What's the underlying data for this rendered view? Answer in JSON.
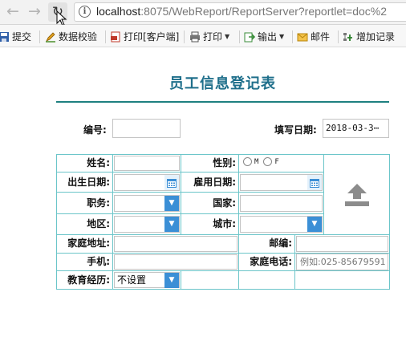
{
  "browser": {
    "url_host": "localhost",
    "url_rest": ":8075/WebReport/ReportServer?reportlet=doc%2"
  },
  "toolbar": {
    "submit": "提交",
    "validate": "数据校验",
    "print_client": "打印[客户端]",
    "print": "打印",
    "export": "输出",
    "mail": "邮件",
    "add_record": "增加记录"
  },
  "form": {
    "title": "员工信息登记表",
    "number_label": "编号:",
    "number_value": "",
    "fill_date_label": "填写日期:",
    "fill_date_value": "2018-03-3⋯",
    "name_label": "姓名:",
    "gender_label": "性别:",
    "gender_options": [
      "M",
      "F"
    ],
    "birth_date_label": "出生日期:",
    "hire_date_label": "雇用日期:",
    "position_label": "职务:",
    "country_label": "国家:",
    "region_label": "地区:",
    "city_label": "城市:",
    "address_label": "家庭地址:",
    "postcode_label": "邮编:",
    "mobile_label": "手机:",
    "home_phone_label": "家庭电话:",
    "home_phone_placeholder": "例如:025-85679591",
    "education_label": "教育经历:",
    "education_value": "不设置"
  },
  "colors": {
    "title": "#1f6f8b",
    "rule": "#1e8080",
    "grid": "#6bc5c9",
    "select_arrow": "#3b8fd6",
    "upload_icon": "#8c8c8c"
  }
}
